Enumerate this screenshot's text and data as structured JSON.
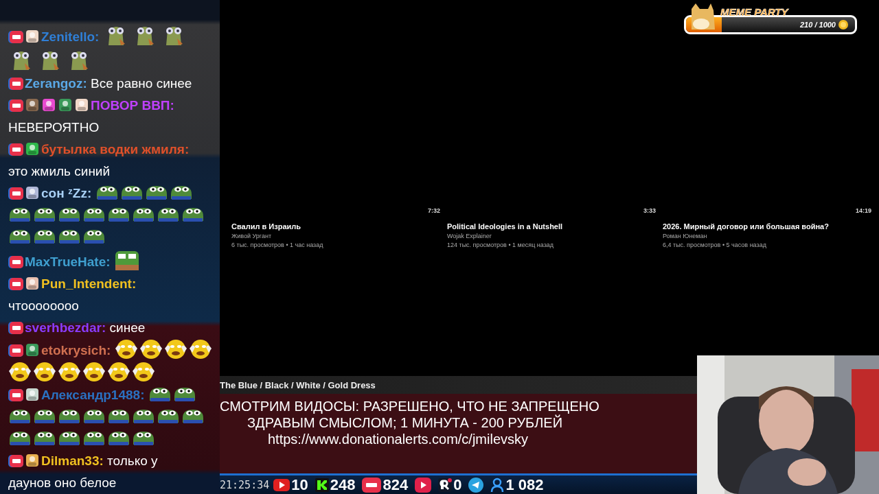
{
  "chat": [
    {
      "user": "Zenitello:",
      "color": "#2f7fd6",
      "badges": [
        {
          "kind": "picture"
        }
      ],
      "emotes": [
        {
          "kind": "lizard"
        },
        {
          "kind": "lizard"
        },
        {
          "kind": "lizard"
        },
        {
          "kind": "lizard"
        },
        {
          "kind": "lizard"
        },
        {
          "kind": "lizard"
        }
      ]
    },
    {
      "user": "Zerangoz:",
      "color": "#5aa8e6",
      "text": "Все равно синее"
    },
    {
      "user": "ПОВОР ВВП:",
      "color": "#c040ff",
      "badges": [
        {
          "kind": "picture"
        },
        {
          "kind": "picture"
        },
        {
          "kind": "picture"
        },
        {
          "kind": "picture"
        }
      ],
      "text": "НЕВЕРОЯТНО",
      "break": true
    },
    {
      "user": "бутылка водки жмиля:",
      "color": "#e0502a",
      "badges": [
        {
          "kind": "picture"
        }
      ],
      "text": "это жмиль синий",
      "break": true
    },
    {
      "user": "сон ᶻZz:",
      "color": "#a8d0f5",
      "badges": [
        {
          "kind": "picture"
        }
      ],
      "emotes": [
        {
          "kind": "frog"
        },
        {
          "kind": "frog"
        },
        {
          "kind": "frog"
        },
        {
          "kind": "frog"
        },
        {
          "kind": "frog"
        },
        {
          "kind": "frog"
        },
        {
          "kind": "frog"
        },
        {
          "kind": "frog"
        },
        {
          "kind": "frog"
        },
        {
          "kind": "frog"
        },
        {
          "kind": "frog"
        },
        {
          "kind": "frog"
        },
        {
          "kind": "frog"
        },
        {
          "kind": "frog"
        },
        {
          "kind": "frog"
        },
        {
          "kind": "frog"
        }
      ]
    },
    {
      "user": "MaxTrueHate:",
      "color": "#3fa0d0",
      "emotes": [
        {
          "kind": "bigfrog"
        }
      ]
    },
    {
      "user": "Pun_Intendent:",
      "color": "#f0c020",
      "badges": [
        {
          "kind": "picture"
        }
      ],
      "text": "чтоооооооо",
      "break": true
    },
    {
      "user": "sverhbezdar:",
      "color": "#8a3cff",
      "text": "синее"
    },
    {
      "user": "etokrysich:",
      "color": "#d07050",
      "badges": [
        {
          "kind": "picture"
        }
      ],
      "emotes": [
        {
          "kind": "smiley"
        },
        {
          "kind": "smiley"
        },
        {
          "kind": "smiley"
        },
        {
          "kind": "smiley"
        },
        {
          "kind": "smiley"
        },
        {
          "kind": "smiley"
        },
        {
          "kind": "smiley"
        },
        {
          "kind": "smiley"
        },
        {
          "kind": "smiley"
        },
        {
          "kind": "smiley"
        }
      ]
    },
    {
      "user": "Александр1488:",
      "color": "#2a70c0",
      "badges": [
        {
          "kind": "picture"
        }
      ],
      "emotes": [
        {
          "kind": "frog"
        },
        {
          "kind": "frog"
        },
        {
          "kind": "frog"
        },
        {
          "kind": "frog"
        },
        {
          "kind": "frog"
        },
        {
          "kind": "frog"
        },
        {
          "kind": "frog"
        },
        {
          "kind": "frog"
        },
        {
          "kind": "frog"
        },
        {
          "kind": "frog"
        },
        {
          "kind": "frog"
        },
        {
          "kind": "frog"
        },
        {
          "kind": "frog"
        },
        {
          "kind": "frog"
        },
        {
          "kind": "frog"
        },
        {
          "kind": "frog"
        }
      ]
    },
    {
      "user": "Dilman33:",
      "color": "#f0c020",
      "badges": [
        {
          "kind": "picture"
        }
      ],
      "text": "только у",
      "text_2": "даунов оно белое"
    }
  ],
  "videos": [
    {
      "duration": "7:32",
      "title": "Свалил в Израиль",
      "channel": "Живой Ургант",
      "meta": "6 тыс. просмотров • 1 час назад"
    },
    {
      "duration": "3:33",
      "title": "Political Ideologies in a Nutshell",
      "channel": "Wojak Explainer",
      "meta": "124 тыс. просмотров • 1 месяц назад"
    },
    {
      "duration": "14:19",
      "title": "2026. Мирный договор или большая война?",
      "channel": "Роман Юнеман",
      "meta": "6,4 тыс. просмотров • 5 часов назад"
    }
  ],
  "meme_party": {
    "title": "MEME PARTY",
    "progress": "210 / 1000",
    "level": 0.21
  },
  "now_playing": "The Blue / Black / White / Gold Dress",
  "donation": [
    "СМОТРИМ ВИДОСЫ: РАЗРЕШЕНО, ЧТО НЕ ЗАПРЕЩЕНО",
    "ЗДРАВЫМ СМЫСЛОМ; 1 МИНУТА - 200 РУБЛЕЙ",
    "https://www.donationalerts.com/c/jmilevsky"
  ],
  "stats": {
    "time": "21:25:34",
    "items": [
      {
        "kind": "youtube",
        "value": "10"
      },
      {
        "kind": "kick",
        "value": "248"
      },
      {
        "kind": "vklive",
        "value": "824"
      },
      {
        "kind": "rutube"
      },
      {
        "kind": "r",
        "value": "0"
      },
      {
        "kind": "telegram"
      },
      {
        "kind": "viewers",
        "value": "1 082"
      }
    ]
  }
}
